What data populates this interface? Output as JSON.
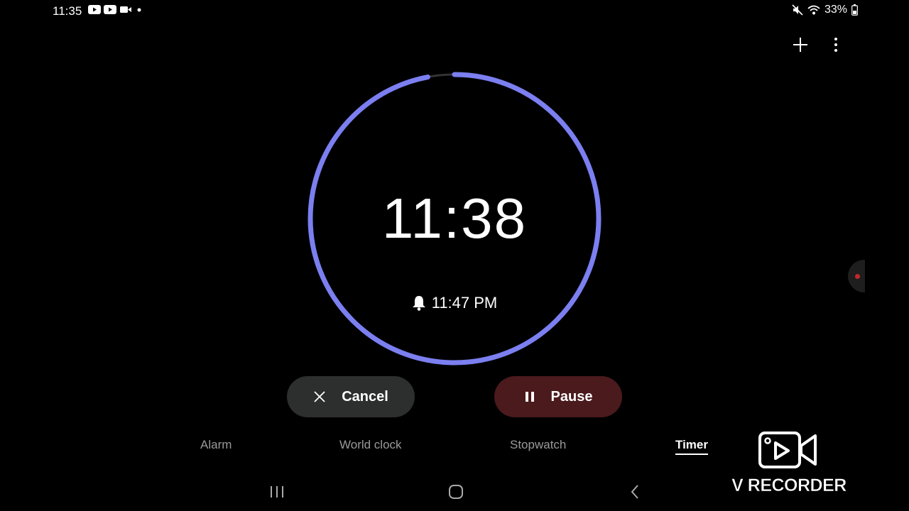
{
  "status": {
    "time": "11:35",
    "battery": "33%"
  },
  "timer": {
    "remaining": "11:38",
    "end_time": "11:47 PM",
    "progress_remaining": 0.97
  },
  "buttons": {
    "cancel": "Cancel",
    "pause": "Pause"
  },
  "tabs": [
    {
      "label": "Alarm",
      "active": false
    },
    {
      "label": "World clock",
      "active": false
    },
    {
      "label": "Stopwatch",
      "active": false
    },
    {
      "label": "Timer",
      "active": true
    }
  ],
  "watermark": {
    "text": "V RECORDER"
  },
  "colors": {
    "ring": "#7b7ff0",
    "cancel_bg": "#2c2f2d",
    "pause_bg": "#4a1a1d"
  },
  "icons": [
    "youtube-icon",
    "video-icon",
    "mute-icon",
    "wifi-icon",
    "battery-icon",
    "plus-icon",
    "more-icon",
    "bell-icon",
    "close-icon",
    "pause-icon",
    "recents-icon",
    "home-icon",
    "back-icon"
  ]
}
